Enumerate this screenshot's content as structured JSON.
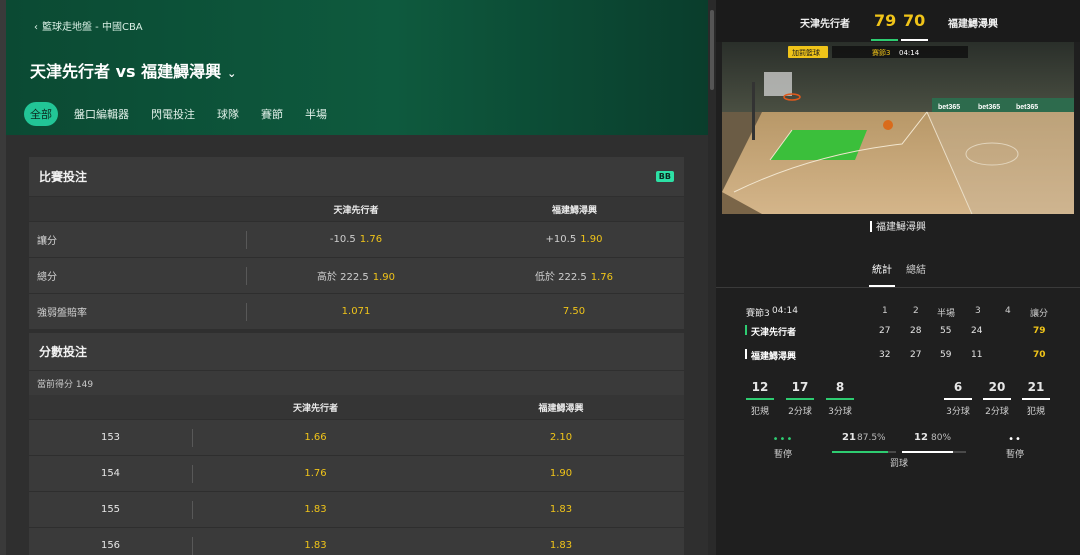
{
  "breadcrumb": "籃球走地盤 - 中國CBA",
  "match_title": "天津先行者 vs 福建鱘潯興",
  "tabs": [
    "全部",
    "盤口編輯器",
    "閃電投注",
    "球隊",
    "賽節",
    "半場"
  ],
  "match_bet": {
    "title": "比賽投注",
    "badge": "BB",
    "team1": "天津先行者",
    "team2": "福建鱘潯興",
    "rows": [
      {
        "label": "讓分",
        "t1_line": "-10.5",
        "t1_odds": "1.76",
        "t2_line": "+10.5",
        "t2_odds": "1.90"
      },
      {
        "label": "總分",
        "t1_line": "高於 222.5",
        "t1_odds": "1.90",
        "t2_line": "低於 222.5",
        "t2_odds": "1.76"
      },
      {
        "label": "強弱盤賠率",
        "t1_line": "",
        "t1_odds": "1.071",
        "t2_line": "",
        "t2_odds": "7.50"
      }
    ]
  },
  "points_bet": {
    "title": "分數投注",
    "sub": "當前得分 149",
    "team1": "天津先行者",
    "team2": "福建鱘潯興",
    "rows": [
      {
        "pts": "153",
        "t1": "1.66",
        "t2": "2.10"
      },
      {
        "pts": "154",
        "t1": "1.76",
        "t2": "1.90"
      },
      {
        "pts": "155",
        "t1": "1.83",
        "t2": "1.83"
      },
      {
        "pts": "156",
        "t1": "1.83",
        "t2": "1.83"
      }
    ]
  },
  "scoreboard": {
    "home": "天津先行者",
    "home_score": "79",
    "away_score": "70",
    "away": "福建鱘潯興",
    "accent": "#f0c419"
  },
  "court": {
    "label": "加罰籃球",
    "period_label": "賽節3",
    "clock": "04:14",
    "caption": "福建鱘潯興",
    "ad_text": "bet365"
  },
  "stat_tabs": [
    "統計",
    "總結"
  ],
  "quarter_table": {
    "period": "賽節3",
    "clock": "04:14",
    "headers": [
      "1",
      "2",
      "半場",
      "3",
      "4",
      "讓分"
    ],
    "rows": [
      {
        "team": "天津先行者",
        "q1": "27",
        "q2": "28",
        "half": "55",
        "q3": "24",
        "q4": "",
        "total": "79",
        "color": "#2ecc71"
      },
      {
        "team": "福建鱘潯興",
        "q1": "32",
        "q2": "27",
        "half": "59",
        "q3": "11",
        "q4": "",
        "total": "70",
        "color": "#ffffff"
      }
    ]
  },
  "team_stats": {
    "home": [
      {
        "value": "12",
        "label": "犯規"
      },
      {
        "value": "17",
        "label": "2分球"
      },
      {
        "value": "8",
        "label": "3分球"
      }
    ],
    "away": [
      {
        "value": "6",
        "label": "3分球"
      },
      {
        "value": "20",
        "label": "2分球"
      },
      {
        "value": "21",
        "label": "犯規"
      }
    ],
    "timeout_label": "暫停",
    "free_throw_label": "罰球",
    "home_ft": "21",
    "home_ft_pct": "87.5%",
    "away_ft": "12",
    "away_ft_pct": "80%",
    "home_ft_fraction": 0.875,
    "away_ft_fraction": 0.8
  }
}
